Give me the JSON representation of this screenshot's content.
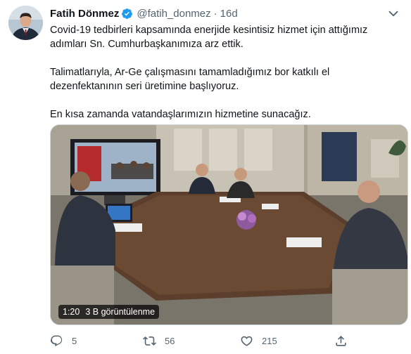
{
  "tweet": {
    "display_name": "Fatih Dönmez",
    "handle": "@fatih_donmez",
    "separator": "·",
    "time": "16d",
    "avatar_icon": "profile-photo",
    "verified_icon": "verified-badge-icon",
    "more_icon": "more-icon",
    "paragraphs": [
      "Covid-19 tedbirleri kapsamında enerjide kesintisiz hizmet için attığımız adımları Sn. Cumhurbaşkanımıza arz ettik.",
      "Talimatlarıyla, Ar-Ge çalışmasını tamamladığımız bor katkılı el dezenfektanının seri üretimine başlıyoruz.",
      "En kısa zamanda vatandaşlarımızın hizmetine sunacağız."
    ],
    "media": {
      "type": "video",
      "duration": "1:20",
      "views": "3 B görüntülenme"
    },
    "actions": {
      "reply_count": "5",
      "retweet_count": "56",
      "like_count": "215"
    }
  },
  "colors": {
    "text": "#0f1419",
    "secondary": "#536471",
    "verified": "#1d9bf0",
    "border": "#cfd9de"
  }
}
